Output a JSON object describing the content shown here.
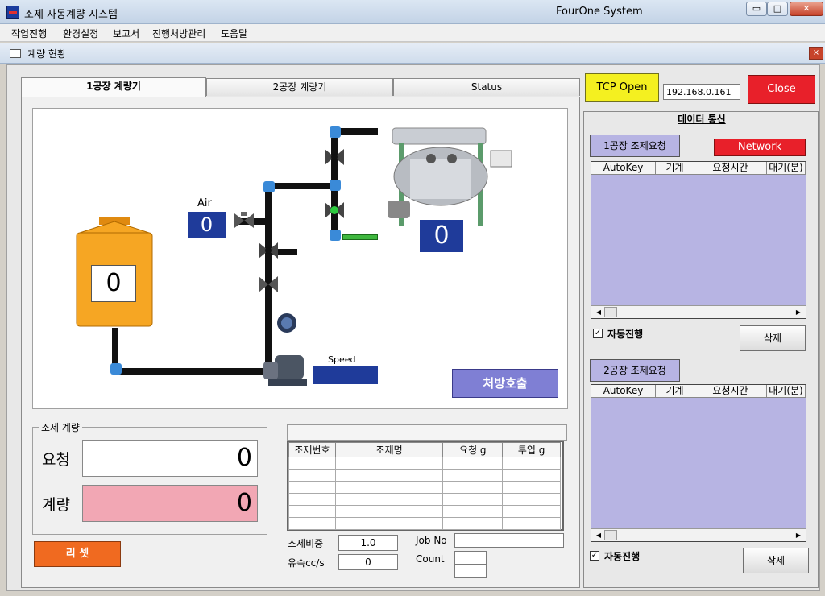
{
  "window": {
    "title": "조제 자동계량 시스템",
    "system_name": "FourOne System",
    "minimize": "▭",
    "maximize": "□",
    "close": "✕"
  },
  "menu": [
    "작업진행",
    "환경설정",
    "보고서",
    "진행처방관리",
    "도움말"
  ],
  "child_window": {
    "title": "계량 현황",
    "close": "×"
  },
  "tabs": [
    "1공장 계량기",
    "2공장 계량기",
    "Status"
  ],
  "diagram": {
    "tank_value": "0",
    "air_label": "Air",
    "air_value": "0",
    "mixer_value": "0",
    "speed_label": "Speed",
    "speed_value": "",
    "prescription_button": "처방호출"
  },
  "weighing": {
    "group_title": "조제 계량",
    "request_label": "요청",
    "request_value": "0",
    "measure_label": "계량",
    "measure_value": "0",
    "reset_button": "리 셋"
  },
  "recipe_table": {
    "headers": [
      "조제번호",
      "조제명",
      "요청 g",
      "투입 g"
    ],
    "rows": [
      [
        "",
        "",
        "",
        ""
      ],
      [
        "",
        "",
        "",
        ""
      ],
      [
        "",
        "",
        "",
        ""
      ],
      [
        "",
        "",
        "",
        ""
      ],
      [
        "",
        "",
        "",
        ""
      ],
      [
        "",
        "",
        "",
        ""
      ]
    ]
  },
  "fields": {
    "ratio_label": "조제비중",
    "ratio_value": "1.0",
    "flow_label": "유속cc/s",
    "flow_value": "0",
    "jobno_label": "Job No",
    "jobno_value": "",
    "count_label": "Count",
    "count_value": ""
  },
  "network": {
    "tcp_open_button": "TCP Open",
    "ip_address": "192.168.0.161",
    "close_button": "Close",
    "data_comm_title": "데이터 통신",
    "network_status": "Network"
  },
  "plant1": {
    "request_button": "1공장 조제요청",
    "columns": [
      "AutoKey",
      "기계",
      "요청시간",
      "대기(분)"
    ],
    "auto_label": "자동진행",
    "auto_checked": "✓",
    "delete_button": "삭제"
  },
  "plant2": {
    "request_button": "2공장 조제요청",
    "columns": [
      "AutoKey",
      "기계",
      "요청시간",
      "대기(분)"
    ],
    "auto_label": "자동진행",
    "auto_checked": "✓",
    "delete_button": "삭제"
  },
  "colors": {
    "tank": "#f6a623",
    "value_blue": "#1f3b9a",
    "list_bg": "#b7b4e3",
    "tcp_yellow": "#f4f020",
    "close_red": "#e8202a",
    "reset_orange": "#f06a20",
    "measure_pink": "#f2a7b4",
    "request_btn": "#b7b4e3"
  }
}
